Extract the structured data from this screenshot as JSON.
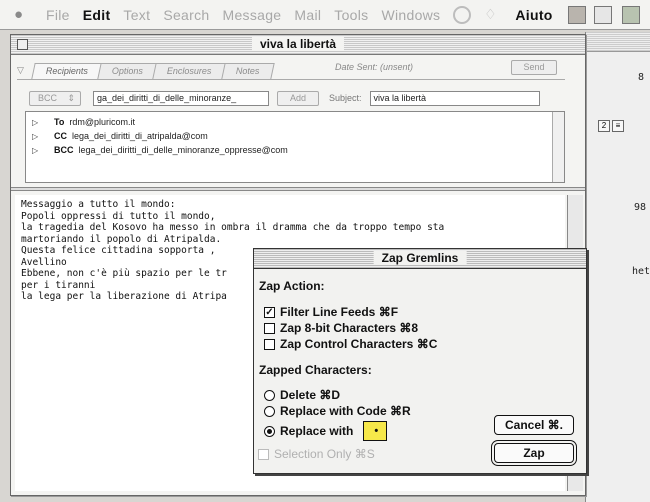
{
  "menubar": {
    "items": [
      "File",
      "Edit",
      "Text",
      "Search",
      "Message",
      "Mail",
      "Tools",
      "Windows"
    ],
    "active": "Edit",
    "help": "Aiuto"
  },
  "bg_window": {
    "text1": "8",
    "text2": "98",
    "text3": "het"
  },
  "message_window": {
    "title": "viva la libertà",
    "tabs": [
      "Recipients",
      "Options",
      "Enclosures",
      "Notes"
    ],
    "date_sent": "Date Sent: (unsent)",
    "send_label": "Send",
    "addr_type": "BCC",
    "addr_value": "ga_dei_diritti_di_delle_minoranze_",
    "add_label": "Add",
    "subject_label": "Subject:",
    "subject_value": "viva la libertà",
    "recipients": [
      {
        "kind": "To",
        "address": "rdm@pluricom.it"
      },
      {
        "kind": "CC",
        "address": "lega_dei_diritti_di_atripalda@com"
      },
      {
        "kind": "BCC",
        "address": "lega_dei_diritti_di_delle_minoranze_oppresse@com"
      }
    ],
    "body_lines": [
      "Messaggio a tutto il mondo:",
      "",
      "Popoli oppressi di tutto il mondo,",
      "la tragedia del Kosovo ha messo in ombra il dramma che da troppo tempo sta",
      "martoriando il popolo di Atripalda.",
      "Questa felice cittadina sopporta ,",
      "Avellino",
      "Ebbene, non c'è più spazio per le tr",
      "per i tiranni",
      "",
      "la lega per la liberazione di Atripa"
    ]
  },
  "zap_dialog": {
    "title": "Zap Gremlins",
    "zap_action_label": "Zap Action:",
    "actions": [
      {
        "label": "Filter Line Feeds ⌘F",
        "checked": true
      },
      {
        "label": "Zap 8-bit Characters ⌘8",
        "checked": false
      },
      {
        "label": "Zap Control Characters ⌘C",
        "checked": false
      }
    ],
    "zapped_label": "Zapped Characters:",
    "zapped_options": [
      {
        "label": "Delete ⌘D",
        "selected": false
      },
      {
        "label": "Replace with Code ⌘R",
        "selected": false
      },
      {
        "label": "Replace with",
        "selected": true
      }
    ],
    "replace_char": "•",
    "selection_only": "Selection Only ⌘S",
    "cancel_label": "Cancel ⌘.",
    "zap_label": "Zap"
  }
}
